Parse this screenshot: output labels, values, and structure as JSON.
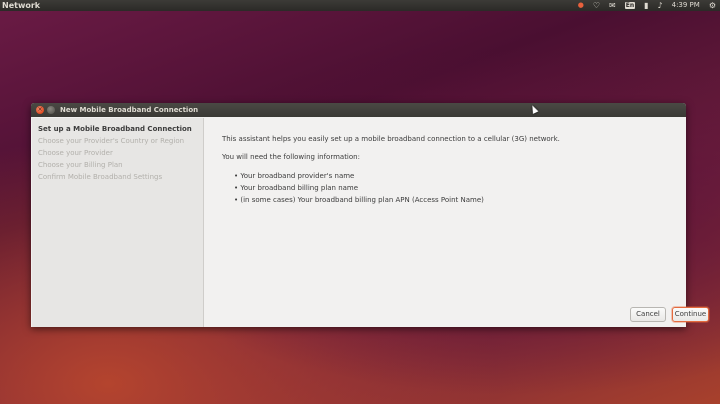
{
  "topbar": {
    "app_title": "Network",
    "clock": "4:39 PM",
    "keyboard_indicator": "En",
    "icons": [
      "record-icon",
      "wifi-icon",
      "mail-icon",
      "keyboard-icon",
      "battery-icon",
      "volume-icon",
      "clock",
      "gear-icon"
    ]
  },
  "window": {
    "title": "New Mobile Broadband Connection",
    "steps": [
      "Set up a Mobile Broadband Connection",
      "Choose your Provider's Country or Region",
      "Choose your Provider",
      "Choose your Billing Plan",
      "Confirm Mobile Broadband Settings"
    ],
    "intro": "This assistant helps you easily set up a mobile broadband connection to a cellular (3G) network.",
    "need_info": "You will need the following information:",
    "bullets": [
      "• Your broadband provider's name",
      "• Your broadband billing plan name",
      "• (in some cases) Your broadband billing plan APN (Access Point Name)"
    ],
    "cancel_label": "Cancel",
    "continue_label": "Continue"
  },
  "colors": {
    "accent": "#e46a3e",
    "panel_bg": "#3c3b37"
  }
}
